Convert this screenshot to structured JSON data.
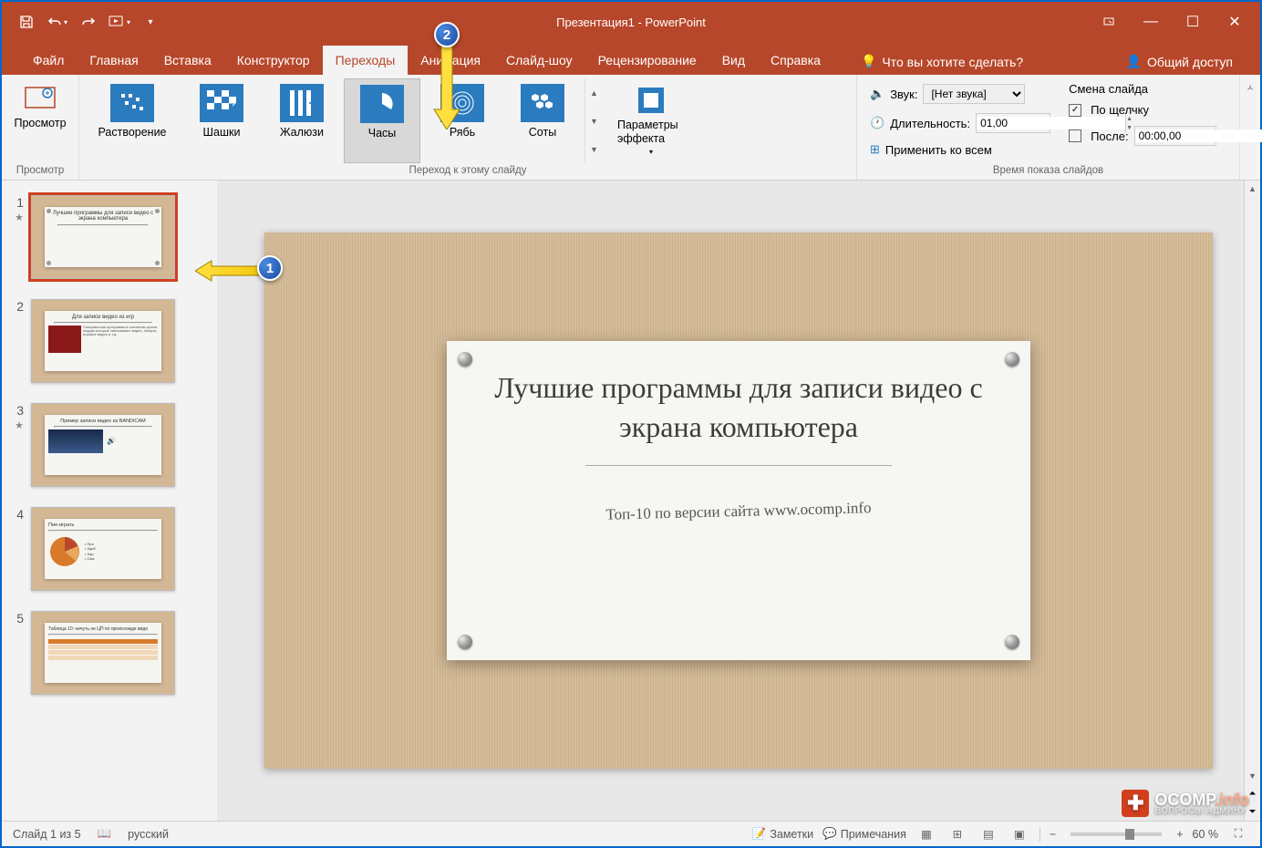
{
  "title": "Презентация1  -  PowerPoint",
  "tabs": [
    "Файл",
    "Главная",
    "Вставка",
    "Конструктор",
    "Переходы",
    "Анимация",
    "Слайд-шоу",
    "Рецензирование",
    "Вид",
    "Справка"
  ],
  "active_tab_index": 4,
  "tell_me_placeholder": "Что вы хотите сделать?",
  "share_label": "Общий доступ",
  "ribbon": {
    "preview": {
      "btn": "Просмотр",
      "group": "Просмотр"
    },
    "transitions": [
      "Растворение",
      "Шашки",
      "Жалюзи",
      "Часы",
      "Рябь",
      "Соты"
    ],
    "selected_transition_index": 3,
    "transitions_group": "Переход к этому слайду",
    "effect_options": "Параметры эффекта",
    "timing": {
      "sound_label": "Звук:",
      "sound_value": "[Нет звука]",
      "duration_label": "Длительность:",
      "duration_value": "01,00",
      "apply_all": "Применить ко всем",
      "advance_title": "Смена слайда",
      "on_click": "По щелчку",
      "after": "После:",
      "after_value": "00:00,00",
      "group": "Время показа слайдов"
    }
  },
  "thumbnails": [
    {
      "num": "1",
      "star": true,
      "title": "Лучшие программы для записи видео с экрана компьютера"
    },
    {
      "num": "2",
      "star": false,
      "title": "Для записи видео из игр"
    },
    {
      "num": "3",
      "star": true,
      "title": "Пример записи видео из BANDICAM"
    },
    {
      "num": "4",
      "star": false,
      "title": "Пие-играть"
    },
    {
      "num": "5",
      "star": false,
      "title": "Таблица 10: ничуть не ЦП по происхожде видо"
    }
  ],
  "slide": {
    "title": "Лучшие программы для записи видео с экрана компьютера",
    "subtitle": "Топ-10 по версии сайта www.ocomp.info"
  },
  "status": {
    "slide_count": "Слайд 1 из 5",
    "lang": "русский",
    "notes": "Заметки",
    "comments": "Примечания",
    "zoom": "60 %"
  },
  "callouts": {
    "1": "1",
    "2": "2"
  },
  "watermark": {
    "brand": "OCOMP",
    "tld": ".info",
    "sub": "ВОПРОСЫ АДМИНУ"
  }
}
